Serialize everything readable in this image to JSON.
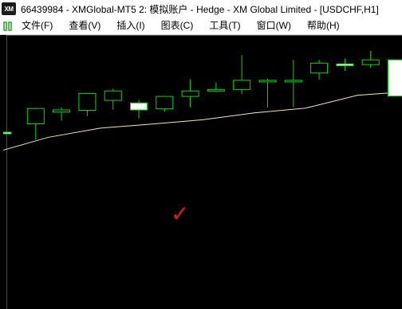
{
  "window": {
    "logo_text": "XM",
    "title": "66439984 - XMGlobal-MT5 2: 模拟账户 - Hedge - XM Global Limited - [USDCHF,H1]"
  },
  "menu": {
    "items": [
      {
        "label": "文件(F)"
      },
      {
        "label": "查看(V)"
      },
      {
        "label": "插入(I)"
      },
      {
        "label": "图表(C)"
      },
      {
        "label": "工具(T)"
      },
      {
        "label": "窗口(W)"
      },
      {
        "label": "帮助(H)"
      }
    ]
  },
  "annotation": {
    "mark": "✓",
    "color": "#e01818"
  },
  "colors": {
    "background": "#000000",
    "bull_candle": "#ffffff",
    "candle_outline": "#00dd00",
    "moving_average": "#f5e6b0"
  },
  "chart_data": {
    "type": "candlestick",
    "symbol": "USDCHF",
    "timeframe": "H1",
    "candles": [
      {
        "open": 8.4,
        "high": 8.4,
        "low": 7.9,
        "close": 8.0
      },
      {
        "open": 10.7,
        "high": 11.6,
        "low": 6.4,
        "close": 14.9
      },
      {
        "open": 13.9,
        "high": 15.2,
        "low": 11.6,
        "close": 14.5
      },
      {
        "open": 14.4,
        "high": 17.1,
        "low": 12.8,
        "close": 19.0
      },
      {
        "open": 17.1,
        "high": 20.3,
        "low": 14.6,
        "close": 19.7
      },
      {
        "open": 16.4,
        "high": 17.2,
        "low": 12.2,
        "close": 14.5
      },
      {
        "open": 14.8,
        "high": 18.2,
        "low": 14.0,
        "close": 18.2
      },
      {
        "open": 18.2,
        "high": 22.9,
        "low": 15.2,
        "close": 19.7
      },
      {
        "open": 19.7,
        "high": 22.0,
        "low": 19.4,
        "close": 20.1
      },
      {
        "open": 20.1,
        "high": 29.5,
        "low": 18.8,
        "close": 22.6
      },
      {
        "open": 22.6,
        "high": 23.0,
        "low": 15.2,
        "close": 22.6
      },
      {
        "open": 22.5,
        "high": 28.2,
        "low": 15.3,
        "close": 22.6
      },
      {
        "open": 24.6,
        "high": 28.2,
        "low": 22.8,
        "close": 27.3
      },
      {
        "open": 27.1,
        "high": 28.6,
        "low": 25.2,
        "close": 26.6
      },
      {
        "open": 26.9,
        "high": 30.7,
        "low": 26.0,
        "close": 28.2
      },
      {
        "open": 28.2,
        "high": 28.2,
        "low": 18.3,
        "close": 18.3
      }
    ],
    "moving_average": [
      {
        "i": -0.5,
        "v": 3.0
      },
      {
        "i": 1.5,
        "v": 7.0
      },
      {
        "i": 3.5,
        "v": 9.5
      },
      {
        "i": 5.5,
        "v": 10.6
      },
      {
        "i": 7.5,
        "v": 11.8
      },
      {
        "i": 9.5,
        "v": 13.7
      },
      {
        "i": 11.5,
        "v": 15.0
      },
      {
        "i": 13.5,
        "v": 18.5
      },
      {
        "i": 14.7,
        "v": 19.1
      },
      {
        "i": 16.0,
        "v": 19.1
      }
    ],
    "ylim": [
      -40,
      35
    ]
  }
}
